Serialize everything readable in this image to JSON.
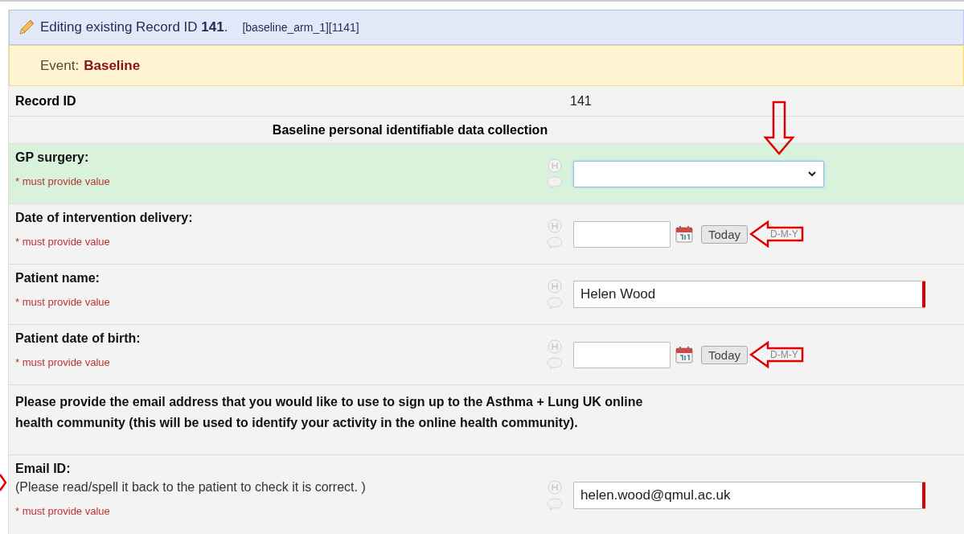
{
  "header": {
    "title": "Editing existing Record ID **141**.",
    "context": "[baseline_arm_1][1141]"
  },
  "event": {
    "label": "Event:",
    "value": "Baseline"
  },
  "record": {
    "label": "Record ID",
    "value": "141"
  },
  "section": "Baseline personal identifiable data collection",
  "rows": [
    {
      "kind": "select",
      "label": "GP surgery:",
      "note": "* must provide value",
      "value": "",
      "highlighted": true,
      "arrow_down": true,
      "arrow_left": false,
      "arrow_edge": false
    },
    {
      "kind": "date",
      "label": "Date of intervention delivery:",
      "note": "* must provide value",
      "value": "",
      "button": "Today",
      "format": "D-M-Y",
      "highlighted": false,
      "arrow_down": false,
      "arrow_left": true,
      "arrow_edge": false
    },
    {
      "kind": "text",
      "label": "Patient name:",
      "note": "* must provide value",
      "value": "Helen Wood",
      "highlighted": false,
      "marked": true,
      "arrow_down": false,
      "arrow_left": false,
      "arrow_edge": false
    },
    {
      "kind": "date",
      "label": "Patient date of birth:",
      "note": "* must provide value",
      "value": "",
      "button": "Today",
      "format": "D-M-Y",
      "highlighted": false,
      "arrow_down": false,
      "arrow_left": true,
      "arrow_edge": false
    },
    {
      "kind": "descriptive",
      "label": "Please provide the email address that you would like to use to sign up to the Asthma + Lung UK online health community (this will be used to identify your activity in the online health community)."
    },
    {
      "kind": "text",
      "label": "Email ID:",
      "hint": "(Please read/spell it back to the patient to check it is correct. )",
      "note": "* must provide value",
      "value": "helen.wood@qmul.ac.uk",
      "highlighted": false,
      "marked": true,
      "arrow_down": false,
      "arrow_left": false,
      "arrow_edge": true
    }
  ]
}
